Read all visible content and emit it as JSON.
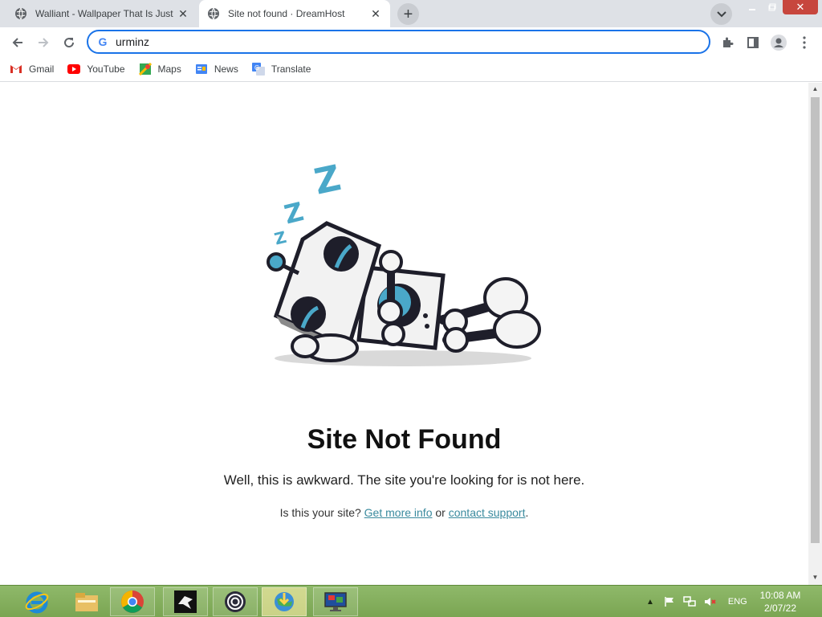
{
  "browser": {
    "tabs": [
      {
        "title": "Walliant - Wallpaper That Is Just",
        "active": false
      },
      {
        "title": "Site not found · DreamHost",
        "active": true
      }
    ],
    "address": "urminz",
    "bookmarks": [
      {
        "label": "Gmail",
        "icon": "gmail-icon"
      },
      {
        "label": "YouTube",
        "icon": "youtube-icon"
      },
      {
        "label": "Maps",
        "icon": "maps-icon"
      },
      {
        "label": "News",
        "icon": "news-icon"
      },
      {
        "label": "Translate",
        "icon": "translate-icon"
      }
    ]
  },
  "page": {
    "heading": "Site Not Found",
    "subtext": "Well, this is awkward. The site you're looking for is not here.",
    "support_prefix": "Is this your site?",
    "support_link1": "Get more info",
    "support_mid": "or",
    "support_link2": "contact support",
    "support_suffix": "."
  },
  "taskbar": {
    "apps": [
      "internet-explorer",
      "file-explorer",
      "chrome",
      "app-wolf",
      "uplay",
      "globe-app",
      "monitor-app"
    ],
    "language": "ENG",
    "time": "10:08 AM",
    "date": "2/07/22"
  },
  "colors": {
    "accent": "#1a73e8",
    "link": "#3a8a9e",
    "taskbar": "#8fb96a",
    "robot_teal": "#4aa8c9"
  }
}
